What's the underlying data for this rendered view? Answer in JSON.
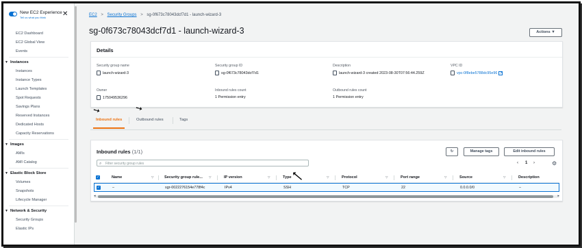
{
  "sidebar": {
    "experience_title": "New EC2 Experience",
    "experience_sub": "Tell us what you think",
    "close_label": "✕",
    "top_items": [
      "EC2 Dashboard",
      "EC2 Global View",
      "Events"
    ],
    "sections": [
      {
        "title": "Instances",
        "items": [
          "Instances",
          "Instance Types",
          "Launch Templates",
          "Spot Requests",
          "Savings Plans",
          "Reserved Instances",
          "Dedicated Hosts",
          "Capacity Reservations"
        ]
      },
      {
        "title": "Images",
        "items": [
          "AMIs",
          "AMI Catalog"
        ]
      },
      {
        "title": "Elastic Block Store",
        "items": [
          "Volumes",
          "Snapshots",
          "Lifecycle Manager"
        ]
      },
      {
        "title": "Network & Security",
        "items": [
          "Security Groups",
          "Elastic IPs"
        ]
      }
    ]
  },
  "breadcrumb": {
    "root": "EC2",
    "parent": "Security Groups",
    "current": "sg-0f673c78043dcf7d1 - launch-wizard-3"
  },
  "page_title": "sg-0f673c78043dcf7d1 - launch-wizard-3",
  "actions_label": "Actions ▼",
  "details": {
    "header": "Details",
    "fields": [
      {
        "label": "Security group name",
        "value": "launch-wizard-3",
        "copy": true
      },
      {
        "label": "Security group ID",
        "value": "sg-0f673c78043dcf7d1",
        "copy": true
      },
      {
        "label": "Description",
        "value": "launch-wizard-3 created 2023-08-30T07:56:44.259Z",
        "copy": true
      },
      {
        "label": "VPC ID",
        "value": "vpc-0f8ebe5788dc95e96",
        "copy": true,
        "link": true
      },
      {
        "label": "Owner",
        "value": "175049536296",
        "copy": true
      },
      {
        "label": "Inbound rules count",
        "value": "1 Permission entry"
      },
      {
        "label": "Outbound rules count",
        "value": "1 Permission entry"
      }
    ]
  },
  "tabs": {
    "inbound": "Inbound rules",
    "outbound": "Outbound rules",
    "tags": "Tags",
    "active": "inbound"
  },
  "inbound": {
    "title": "Inbound rules",
    "count": "(1/1)",
    "refresh_label": "↻",
    "manage_tags_label": "Manage tags",
    "edit_label": "Edit inbound rules",
    "filter_placeholder": "Filter security group rules",
    "page_number": "1",
    "columns": [
      "Name",
      "Security group rule...",
      "IP version",
      "Type",
      "Protocol",
      "Port range",
      "Source",
      "Description"
    ],
    "rows": [
      [
        "–",
        "sgr-0022276154e778f4c",
        "IPv4",
        "SSH",
        "TCP",
        "22",
        "0.0.0.0/0",
        "–"
      ]
    ]
  },
  "colors": {
    "accent_orange": "#ec7211",
    "link_blue": "#0972d3",
    "selection_bg": "#f1faff"
  }
}
